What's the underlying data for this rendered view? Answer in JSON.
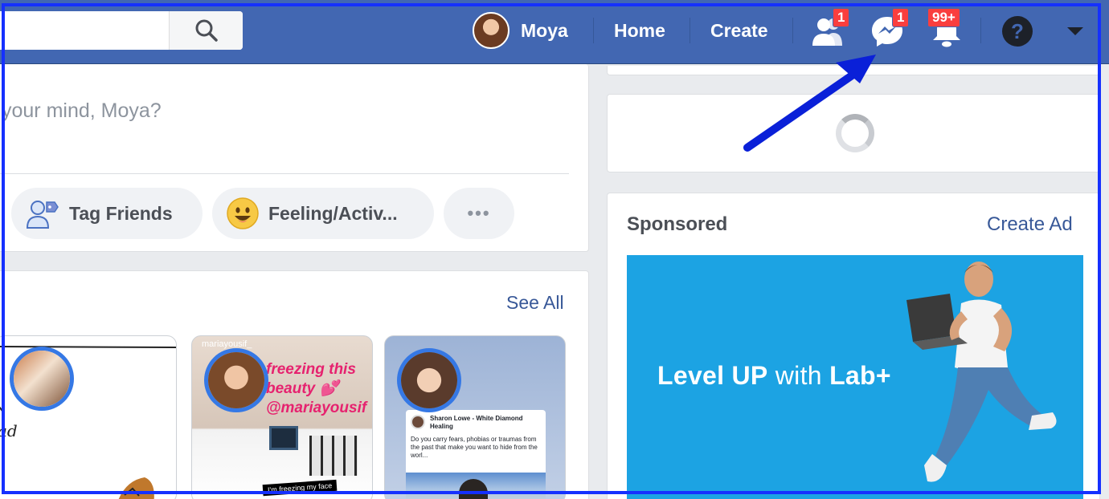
{
  "topbar": {
    "search_placeholder": "",
    "user_name": "Moya",
    "home_label": "Home",
    "create_label": "Create",
    "friend_requests_count": "1",
    "messages_count": "1",
    "notifications_count": "99+",
    "icons": [
      "search-icon",
      "friends-icon",
      "messenger-icon",
      "notifications-icon",
      "help-icon",
      "caret-down-icon"
    ]
  },
  "composer": {
    "prompt": "your mind, Moya?",
    "tag_friends_label": "Tag Friends",
    "feeling_label": "Feeling/Activ...",
    "more_label": "•••"
  },
  "stories": {
    "see_all_label": "See All",
    "items": [
      {
        "handwriting": "ad"
      },
      {
        "username": "mariayousif_",
        "caption": "freezing this beauty 💕 @mariayousif",
        "sticker": "I'm freezing my face"
      },
      {
        "post_author": "Sharon Lowe - White Diamond Healing",
        "post_text": "Do you carry fears, phobias or traumas from the past that make you want to hide from the worl..."
      }
    ]
  },
  "sponsored": {
    "title": "Sponsored",
    "create_ad_label": "Create Ad",
    "ad_headline_bold_1": "Level UP",
    "ad_headline_light": " with ",
    "ad_headline_bold_2": "Lab+"
  },
  "colors": {
    "topbar": "#4267b2",
    "badge": "#fa3e3e",
    "link": "#385898",
    "annotation": "#1530ff",
    "ad_background": "#1ca3e3"
  }
}
